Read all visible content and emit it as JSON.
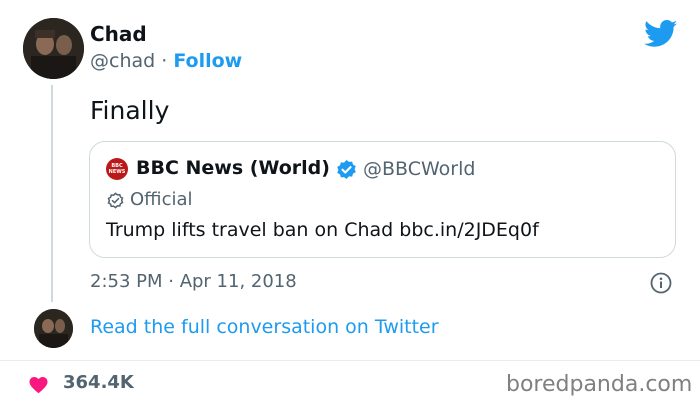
{
  "tweet": {
    "author_name": "Chad",
    "author_handle": "@chad",
    "separator": " · ",
    "follow_label": "Follow",
    "text": "Finally",
    "timestamp": "2:53 PM · Apr 11, 2018",
    "read_full_label": "Read the full conversation on Twitter",
    "likes": "364.4K"
  },
  "quoted": {
    "logo_text": [
      "BBC",
      "NEWS"
    ],
    "name": "BBC News (World)",
    "handle": "@BBCWorld",
    "official_label": "Official",
    "text": "Trump lifts travel ban on Chad bbc.in/2JDEq0f"
  },
  "watermark": "boredpanda.com",
  "colors": {
    "accent": "#1d9bf0",
    "heart": "#f91880",
    "bbc_red": "#bb1919",
    "secondary_text": "#536471"
  },
  "icons": [
    "twitter-bird-icon",
    "verified-badge-icon",
    "official-check-icon",
    "info-icon",
    "heart-icon"
  ]
}
